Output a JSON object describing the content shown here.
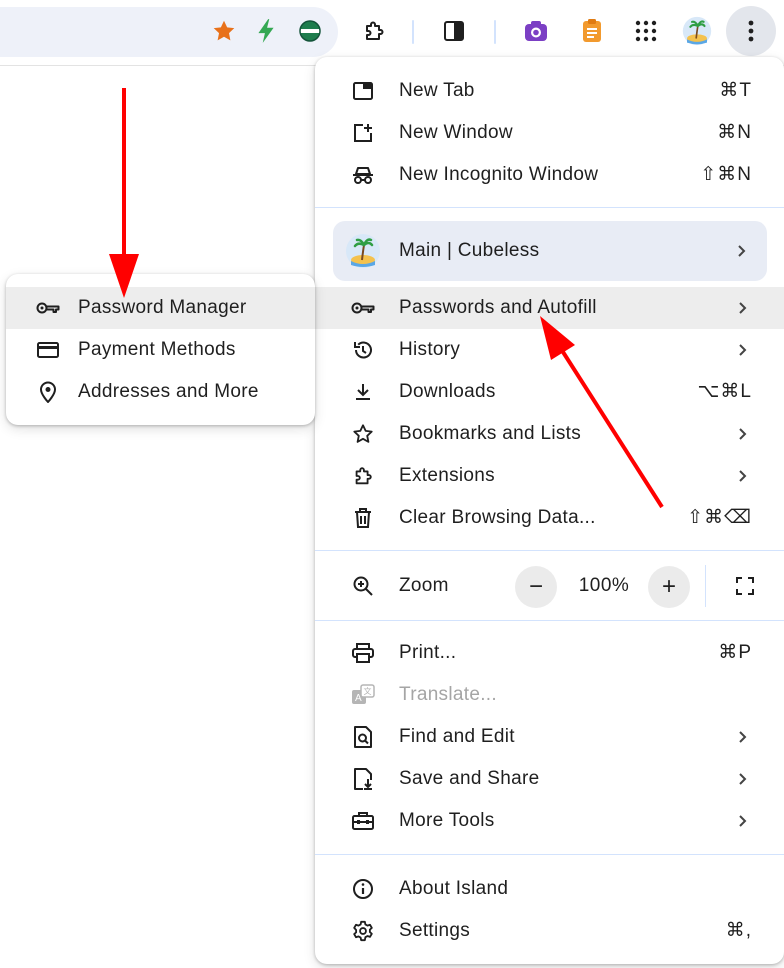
{
  "toolbar": {
    "icons": [
      "bookmark-star-icon",
      "bolt-icon",
      "colored-globe-icon",
      "extensions-icon",
      "side-panel-icon",
      "screenshot-camera-icon",
      "notes-icon",
      "apps-grid-icon",
      "profile-avatar-icon",
      "more-menu-icon"
    ],
    "star_color": "#e8711a",
    "bolt_color": "#34a853"
  },
  "main_menu": {
    "new_tab": {
      "label": "New Tab",
      "shortcut": "⌘T"
    },
    "new_window": {
      "label": "New Window",
      "shortcut": "⌘N"
    },
    "new_incognito": {
      "label": "New Incognito Window",
      "shortcut": "⇧⌘N"
    },
    "profile": {
      "label": "Main | Cubeless"
    },
    "passwords": {
      "label": "Passwords and Autofill"
    },
    "history": {
      "label": "History"
    },
    "downloads": {
      "label": "Downloads",
      "shortcut": "⌥⌘L"
    },
    "bookmarks": {
      "label": "Bookmarks and Lists"
    },
    "extensions": {
      "label": "Extensions"
    },
    "clear_data": {
      "label": "Clear Browsing Data...",
      "shortcut": "⇧⌘⌫"
    },
    "zoom": {
      "label": "Zoom",
      "minus": "−",
      "value": "100%",
      "plus": "+"
    },
    "print": {
      "label": "Print...",
      "shortcut": "⌘P"
    },
    "translate": {
      "label": "Translate..."
    },
    "find_edit": {
      "label": "Find and Edit"
    },
    "save_share": {
      "label": "Save and Share"
    },
    "more_tools": {
      "label": "More Tools"
    },
    "about": {
      "label": "About Island"
    },
    "settings": {
      "label": "Settings",
      "shortcut": "⌘,"
    }
  },
  "sub_menu": {
    "password_manager": "Password Manager",
    "payment_methods": "Payment Methods",
    "addresses": "Addresses and More"
  },
  "colors": {
    "annotation_arrow": "#ff0000",
    "divider": "#d3e3fd",
    "hover_bg": "#ededed",
    "profile_bg": "#e8ecf5"
  }
}
